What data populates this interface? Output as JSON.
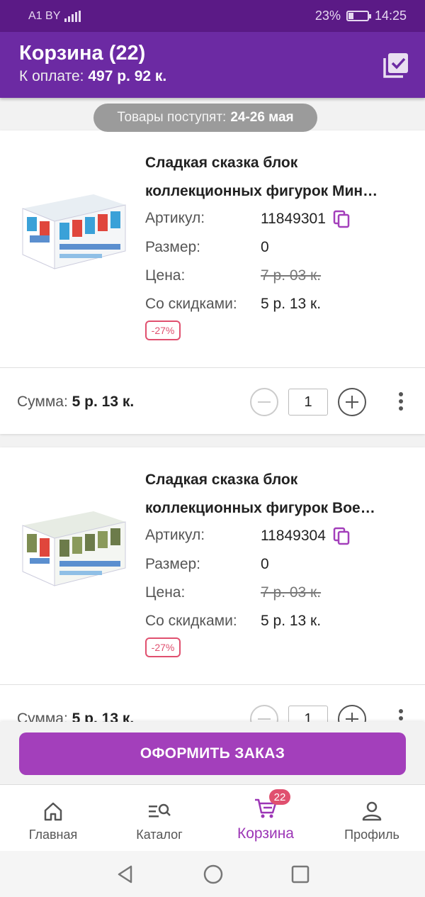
{
  "status_bar": {
    "carrier": "A1 BY",
    "battery": "23%",
    "time": "14:25"
  },
  "header": {
    "title": "Корзина (22)",
    "payment_label": "К оплате:",
    "payment_amount": "497 р. 92 к.",
    "select_all_icon": "check-list-icon"
  },
  "delivery": {
    "label": "Товары поступят:",
    "dates": "24-26 мая"
  },
  "labels": {
    "article": "Артикул:",
    "size": "Размер:",
    "price": "Цена:",
    "discounted": "Со скидками:",
    "sum": "Сумма:"
  },
  "items": [
    {
      "name_line1": "Сладкая сказка блок",
      "name_line2": "коллекционных фигурок Мин…",
      "article": "11849301",
      "size": "0",
      "price": "7 р. 03 к.",
      "discount_price": "5 р. 13 к.",
      "discount": "-27%",
      "sum": "5 р. 13 к.",
      "quantity": "1"
    },
    {
      "name_line1": "Сладкая сказка блок",
      "name_line2": "коллекционных фигурок Вое…",
      "article": "11849304",
      "size": "0",
      "price": "7 р. 03 к.",
      "discount_price": "5 р. 13 к.",
      "discount": "-27%",
      "sum": "5 р. 13 к.",
      "quantity": "1"
    }
  ],
  "checkout": {
    "label": "ОФОРМИТЬ ЗАКАЗ"
  },
  "bottom_nav": [
    {
      "label": "Главная",
      "icon": "home-icon"
    },
    {
      "label": "Каталог",
      "icon": "catalog-search-icon"
    },
    {
      "label": "Корзина",
      "icon": "cart-icon",
      "badge": "22"
    },
    {
      "label": "Профиль",
      "icon": "profile-icon"
    }
  ],
  "colors": {
    "primary": "#6c2aa3",
    "status_bar": "#5b1a86",
    "accent": "#a33fbb",
    "badge": "#e0506f"
  }
}
